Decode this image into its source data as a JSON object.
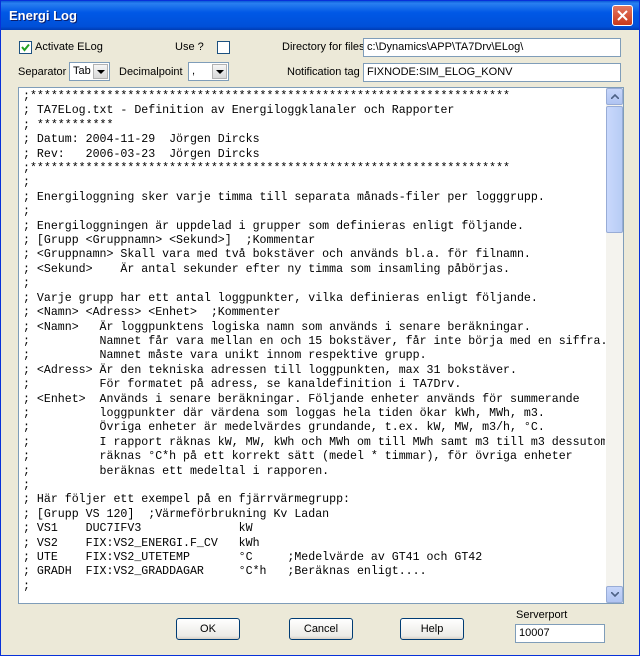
{
  "window": {
    "title": "Energi Log"
  },
  "activate": {
    "label": "Activate ELog",
    "checked": true
  },
  "use": {
    "label": "Use ?",
    "checked": false
  },
  "directory": {
    "label": "Directory for files",
    "value": "c:\\Dynamics\\APP\\TA7Drv\\ELog\\"
  },
  "separator": {
    "label": "Separator",
    "value": "Tab"
  },
  "decimalpoint": {
    "label": "Decimalpoint",
    "value": ","
  },
  "notification": {
    "label": "Notification tag",
    "value": "FIXNODE:SIM_ELOG_KONV"
  },
  "editor": {
    "lines": [
      ";*********************************************************************",
      "; TA7ELog.txt - Definition av Energiloggklanaler och Rapporter",
      "; ***********",
      "; Datum: 2004-11-29  Jörgen Dircks",
      "; Rev:   2006-03-23  Jörgen Dircks",
      ";*********************************************************************",
      ";",
      "; Energiloggning sker varje timma till separata månads-filer per logggrupp.",
      ";",
      "; Energiloggningen är uppdelad i grupper som definieras enligt följande.",
      "; [Grupp <Gruppnamn> <Sekund>]  ;Kommentar",
      "; <Gruppnamn> Skall vara med två bokstäver och används bl.a. för filnamn.",
      "; <Sekund>    Är antal sekunder efter ny timma som insamling påbörjas.",
      ";",
      "; Varje grupp har ett antal loggpunkter, vilka definieras enligt följande.",
      "; <Namn> <Adress> <Enhet>  ;Kommenter",
      "; <Namn>   Är loggpunktens logiska namn som används i senare beräkningar.",
      ";          Namnet får vara mellan en och 15 bokstäver, får inte börja med en siffra.",
      ";          Namnet måste vara unikt innom respektive grupp.",
      "; <Adress> Är den tekniska adressen till loggpunkten, max 31 bokstäver.",
      ";          För formatet på adress, se kanaldefinition i TA7Drv.",
      "; <Enhet>  Används i senare beräkningar. Följande enheter används för summerande",
      ";          loggpunkter där värdena som loggas hela tiden ökar kWh, MWh, m3.",
      ";          Övriga enheter är medelvärdes grundande, t.ex. kW, MW, m3/h, °C.",
      ";          I rapport räknas kW, MW, kWh och MWh om till MWh samt m3 till m3 dessutom",
      ";          räknas °C*h på ett korrekt sätt (medel * timmar), för övriga enheter",
      ";          beräknas ett medeltal i rapporen.",
      ";",
      "; Här följer ett exempel på en fjärrvärmegrupp:",
      "; [Grupp VS 120]  ;Värmeförbrukning Kv Ladan",
      "; VS1    DUC7IFV3              kW",
      "; VS2    FIX:VS2_ENERGI.F_CV   kWh",
      "; UTE    FIX:VS2_UTETEMP       °C     ;Medelvärde av GT41 och GT42",
      "; GRADH  FIX:VS2_GRADDAGAR     °C*h   ;Beräknas enligt....",
      ";"
    ]
  },
  "buttons": {
    "ok": "OK",
    "cancel": "Cancel",
    "help": "Help"
  },
  "serverport": {
    "label": "Serverport",
    "value": "10007"
  }
}
